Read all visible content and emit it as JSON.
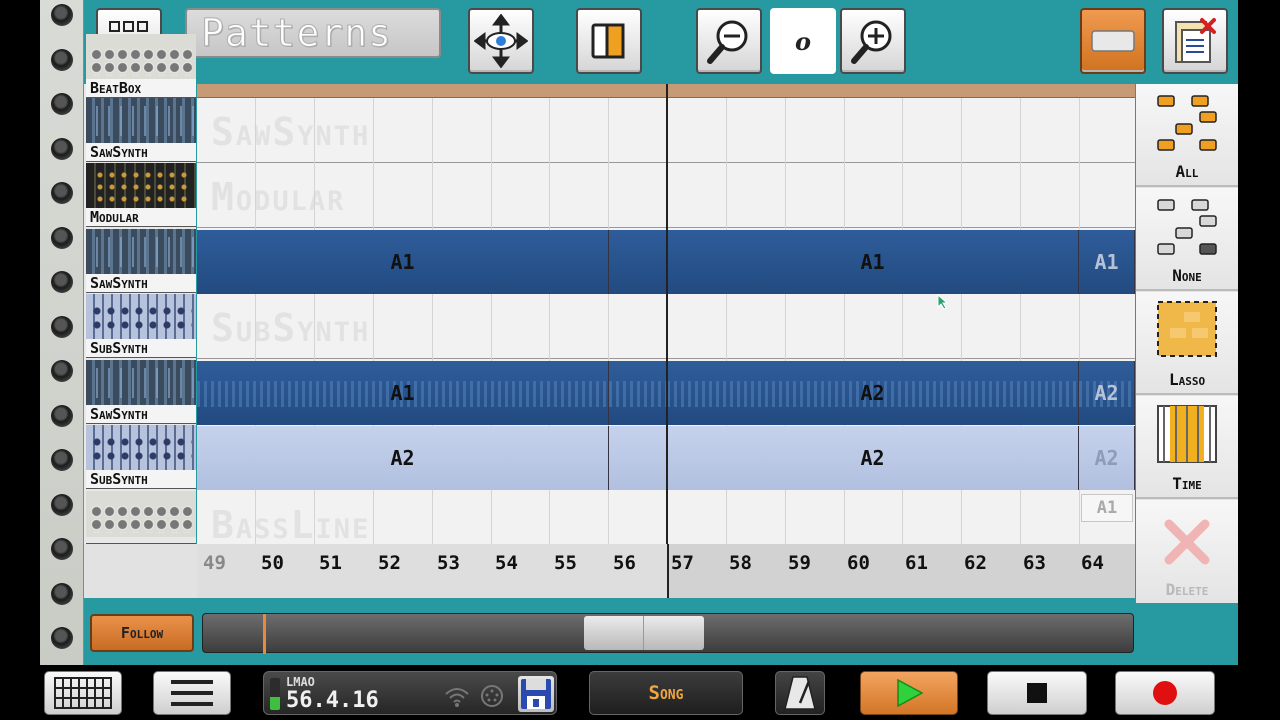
{
  "header": {
    "title": "Patterns",
    "zoom_value": "o"
  },
  "tracks": [
    {
      "label": "BeatBox",
      "type": "beatbox"
    },
    {
      "label": "SawSynth",
      "type": "saw",
      "watermark": "SawSynth"
    },
    {
      "label": "Modular",
      "type": "mod",
      "watermark": "Modular"
    },
    {
      "label": "SawSynth",
      "type": "saw"
    },
    {
      "label": "SubSynth",
      "type": "sub",
      "watermark": "SubSynth"
    },
    {
      "label": "SawSynth",
      "type": "saw"
    },
    {
      "label": "SubSynth",
      "type": "sub"
    },
    {
      "label": "BassLine",
      "type": "bass",
      "watermark": "BassLine"
    }
  ],
  "clips": {
    "lane3": [
      "A1",
      "A1",
      "A1"
    ],
    "lane5": [
      "A1",
      "A2",
      "A2"
    ],
    "lane6": [
      "A2",
      "A2",
      "A2"
    ],
    "lane7": [
      "A1"
    ]
  },
  "bar_numbers": [
    "49",
    "50",
    "51",
    "52",
    "53",
    "54",
    "55",
    "56",
    "57",
    "58",
    "59",
    "60",
    "61",
    "62",
    "63",
    "64"
  ],
  "tools": {
    "all": "All",
    "none": "None",
    "lasso": "Lasso",
    "time": "Time",
    "delete": "Delete"
  },
  "follow_label": "Follow",
  "transport": {
    "lcd_label": "LMAO",
    "position": "56.4.16",
    "song_label": "Song"
  },
  "colors": {
    "frame": "#269aa0",
    "accent_orange": "#e0873a",
    "clip_blue": "#2a5590",
    "clip_light": "#bfcbe8"
  }
}
